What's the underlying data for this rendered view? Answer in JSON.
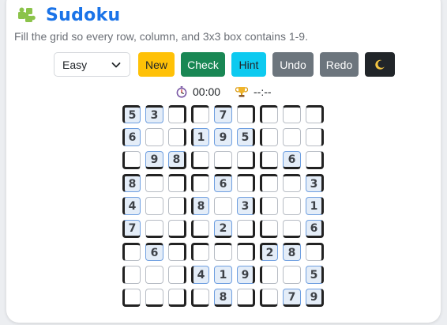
{
  "app": {
    "title": "Sudoku",
    "subtitle": "Fill the grid so every row, column, and 3x3 box contains 1-9.",
    "logo_icon": "puzzle-piece-icon"
  },
  "controls": {
    "difficulty": {
      "selected": "Easy",
      "icon": "chevron-down-icon"
    },
    "new_label": "New",
    "check_label": "Check",
    "hint_label": "Hint",
    "undo_label": "Undo",
    "redo_label": "Redo",
    "dark_mode_icon": "crescent-moon-icon"
  },
  "status": {
    "timer": "00:00",
    "timer_icon": "stopwatch-icon",
    "best": "--:--",
    "best_icon": "trophy-icon"
  },
  "board": {
    "rows": [
      [
        5,
        3,
        0,
        0,
        7,
        0,
        0,
        0,
        0
      ],
      [
        6,
        0,
        0,
        1,
        9,
        5,
        0,
        0,
        0
      ],
      [
        0,
        9,
        8,
        0,
        0,
        0,
        0,
        6,
        0
      ],
      [
        8,
        0,
        0,
        0,
        6,
        0,
        0,
        0,
        3
      ],
      [
        4,
        0,
        0,
        8,
        0,
        3,
        0,
        0,
        1
      ],
      [
        7,
        0,
        0,
        0,
        2,
        0,
        0,
        0,
        6
      ],
      [
        0,
        6,
        0,
        0,
        0,
        0,
        2,
        8,
        0
      ],
      [
        0,
        0,
        0,
        4,
        1,
        9,
        0,
        0,
        5
      ],
      [
        0,
        0,
        0,
        0,
        8,
        0,
        0,
        7,
        9
      ]
    ]
  },
  "colors": {
    "title": "#1a73e8",
    "new": "#ffc107",
    "check": "#198754",
    "hint": "#0dcaf0",
    "undo_redo": "#6c757d",
    "dark_toggle": "#212529",
    "given_cell_bg": "#e4edf8",
    "given_cell_border": "#6f9fe0"
  }
}
